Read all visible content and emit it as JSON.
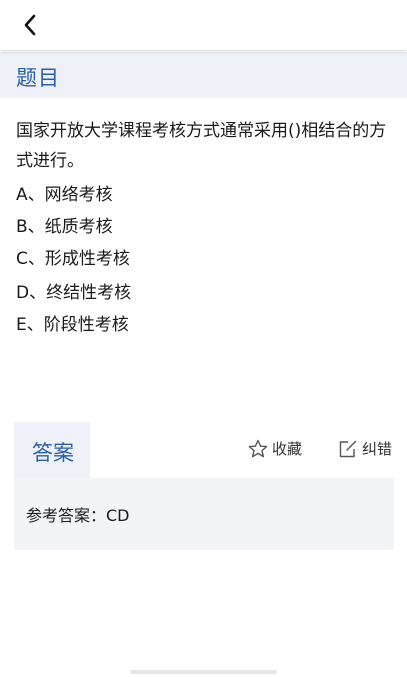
{
  "header": {
    "back_icon": "chevron-left-icon"
  },
  "section": {
    "title": "题目"
  },
  "question": {
    "text": "国家开放大学课程考核方式通常采用()相结合的方式进行。",
    "options": [
      "A、网络考核",
      "B、纸质考核",
      "C、形成性考核",
      "D、终结性考核",
      "E、阶段性考核"
    ]
  },
  "answer_panel": {
    "tab_label": "答案",
    "favorite_label": "收藏",
    "favorite_icon": "star-outline-icon",
    "correct_label": "纠错",
    "correct_icon": "edit-icon",
    "reference_text": "参考答案：CD"
  },
  "colors": {
    "accent": "#2b5ea8",
    "section_bg": "#eef2f8",
    "answer_bg": "#f2f4f7"
  }
}
